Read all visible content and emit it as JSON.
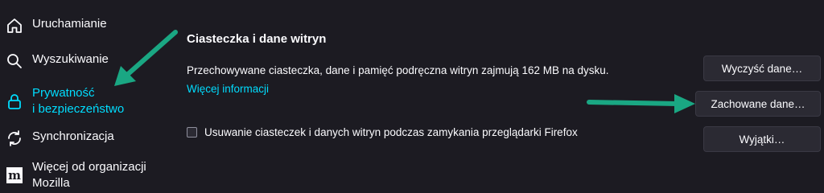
{
  "sidebar": {
    "items": [
      {
        "label": "Uruchamianie",
        "icon": "home-icon"
      },
      {
        "label": "Wyszukiwanie",
        "icon": "search-icon"
      },
      {
        "label": "Prywatność\ni bezpieczeństwo",
        "icon": "lock-icon",
        "selected": true
      },
      {
        "label": "Synchronizacja",
        "icon": "sync-icon"
      },
      {
        "label": "Więcej od organizacji Mozilla",
        "icon": "mozilla-icon"
      }
    ]
  },
  "main": {
    "section_title": "Ciasteczka i dane witryn",
    "usage_text": "Przechowywane ciasteczka, dane i pamięć podręczna witryn zajmują 162 MB na dysku.",
    "learn_more": "Więcej informacji",
    "delete_on_close_label": "Usuwanie ciasteczek i danych witryn podczas zamykania przeglądarki Firefox",
    "delete_on_close_checked": false
  },
  "buttons": {
    "clear_data": "Wyczyść dane…",
    "manage_data": "Zachowane dane…",
    "exceptions": "Wyjątki…"
  },
  "colors": {
    "background": "#1c1b22",
    "accent": "#00ddff",
    "annotation_arrow": "#1aa783"
  }
}
